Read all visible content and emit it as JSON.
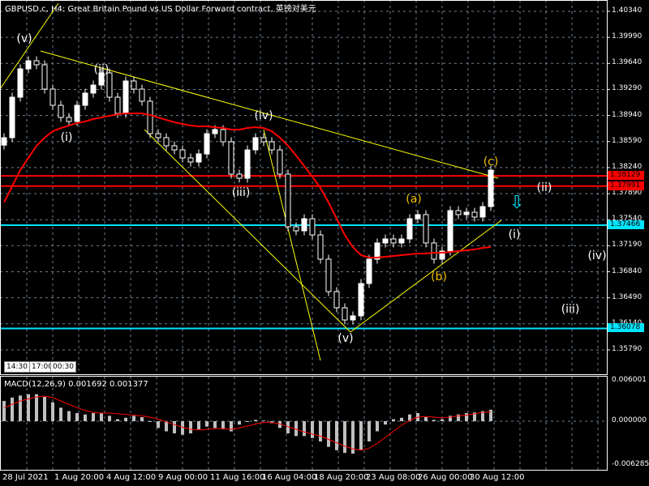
{
  "header": {
    "title": "GBPUSD.c, H4:  Great Britain Pound vs US Dollar Forward contract, 英镑对美元"
  },
  "macd_title": "MACD(12,26,9) 0.001692 0.001377",
  "time_boxes": [
    "14:30",
    "17:00",
    "00:30"
  ],
  "colors": {
    "bg": "#000000",
    "grid": "#6f7f8f",
    "candle": "#ffffff",
    "ma": "#ff0000",
    "trend": "#ffff00",
    "cyan": "#00e5ff",
    "red_level": "#ff0000",
    "macd_hist": "#c0c0c0",
    "macd_signal": "#ff0000"
  },
  "wave_labels": [
    "(v)",
    "(ii)",
    "(i)",
    "(iv)",
    "(iii)",
    "(v)",
    "(a)",
    "(b)",
    "(c)",
    "(ii)",
    "(i)",
    "(iv)",
    "(iii)"
  ],
  "signal_icon": "down-arrow-icon",
  "chart_data": [
    {
      "type": "candlestick",
      "title": "GBPUSD.c, H4",
      "x_tick_labels": [
        "28 Jul 2021",
        "1 Aug 20:00",
        "4 Aug 12:00",
        "9 Aug 00:00",
        "11 Aug 16:00",
        "16 Aug 04:00",
        "18 Aug 20:00",
        "23 Aug 08:00",
        "26 Aug 00:00",
        "30 Aug 12:00"
      ],
      "y_tick_labels": [
        "1.40340",
        "1.39990",
        "1.39640",
        "1.39290",
        "1.38940",
        "1.38590",
        "1.38240",
        "1.37890",
        "1.37540",
        "1.37190",
        "1.36840",
        "1.36490",
        "1.36140",
        "1.35790"
      ],
      "ylim": [
        1.3537,
        1.405
      ],
      "closes": [
        1.38642,
        1.39186,
        1.39567,
        1.39676,
        1.39622,
        1.39295,
        1.39077,
        1.38914,
        1.3886,
        1.39077,
        1.39241,
        1.39349,
        1.39513,
        1.39186,
        1.38968,
        1.39404,
        1.39295,
        1.39132,
        1.38696,
        1.38642,
        1.38533,
        1.38478,
        1.3837,
        1.38315,
        1.38424,
        1.38696,
        1.38751,
        1.38587,
        1.38152,
        1.38097,
        1.38478,
        1.38642,
        1.38587,
        1.38478,
        1.38152,
        1.37444,
        1.3739,
        1.37553,
        1.37335,
        1.37009,
        1.36573,
        1.36356,
        1.36192,
        1.36247,
        1.36682,
        1.37009,
        1.37227,
        1.37281,
        1.37227,
        1.37281,
        1.37553,
        1.37608,
        1.37227,
        1.37009,
        1.37118,
        1.37662,
        1.37608,
        1.3764,
        1.37575,
        1.37716,
        1.38206
      ],
      "moving_average": [
        1.37771,
        1.37989,
        1.38206,
        1.3837,
        1.38533,
        1.38642,
        1.38729,
        1.38772,
        1.38805,
        1.38838,
        1.3886,
        1.38892,
        1.38914,
        1.38936,
        1.38957,
        1.38968,
        1.38968,
        1.38968,
        1.38947,
        1.38914,
        1.38881,
        1.38849,
        1.38827,
        1.38805,
        1.38794,
        1.38794,
        1.38783,
        1.38772,
        1.38751,
        1.38751,
        1.38772,
        1.38783,
        1.38772,
        1.38729,
        1.38642,
        1.38533,
        1.38402,
        1.38261,
        1.38119,
        1.37967,
        1.37771,
        1.37553,
        1.37335,
        1.37172,
        1.37063,
        1.37031,
        1.37031,
        1.37042,
        1.37052,
        1.37063,
        1.37074,
        1.37085,
        1.37085,
        1.37096,
        1.37096,
        1.37107,
        1.37118,
        1.37129,
        1.3714,
        1.37161,
        1.37172
      ],
      "levels": [
        {
          "price": 1.38129,
          "label": "1.38129",
          "color": "#ff0000"
        },
        {
          "price": 1.37991,
          "label": "1.37991",
          "color": "#ff0000"
        },
        {
          "price": 1.37466,
          "label": "1.37466",
          "color": "#00e5ff"
        },
        {
          "price": 1.36078,
          "label": "1.36078",
          "color": "#00e5ff"
        }
      ],
      "grid": true
    },
    {
      "type": "bar+line",
      "title": "MACD(12,26,9)",
      "y_tick_labels": [
        "0.006001",
        "0.000000",
        "-0.006285"
      ],
      "ylim": [
        -0.006285,
        0.006001
      ],
      "histogram": [
        0.003,
        0.0035,
        0.0038,
        0.004,
        0.004,
        0.0036,
        0.0028,
        0.002,
        0.0015,
        0.0012,
        0.001,
        0.0012,
        0.0012,
        0.0008,
        0.0003,
        0.0005,
        0.0008,
        0.0006,
        0.0,
        -0.001,
        -0.0015,
        -0.0018,
        -0.002,
        -0.0018,
        -0.0012,
        -0.0008,
        -0.001,
        -0.0012,
        -0.0015,
        -0.0005,
        0.0,
        0.0002,
        0.0001,
        -0.0003,
        -0.001,
        -0.0018,
        -0.0022,
        -0.0022,
        -0.0025,
        -0.003,
        -0.0038,
        -0.0043,
        -0.0047,
        -0.0048,
        -0.0042,
        -0.003,
        -0.0015,
        -0.0005,
        0.0003,
        0.0005,
        0.001,
        0.0012,
        0.0006,
        0.0002,
        0.0003,
        0.0008,
        0.001,
        0.0012,
        0.0013,
        0.0015,
        0.0017
      ],
      "signal": [
        0.002,
        0.0025,
        0.003,
        0.0033,
        0.0036,
        0.0037,
        0.0035,
        0.003,
        0.0025,
        0.002,
        0.0016,
        0.0013,
        0.0012,
        0.0012,
        0.0011,
        0.001,
        0.0009,
        0.0008,
        0.0006,
        0.0003,
        -0.0001,
        -0.0005,
        -0.0009,
        -0.0012,
        -0.0013,
        -0.0012,
        -0.0011,
        -0.0011,
        -0.0012,
        -0.001,
        -0.0007,
        -0.0004,
        -0.0002,
        -0.0002,
        -0.0004,
        -0.0008,
        -0.0012,
        -0.0016,
        -0.0019,
        -0.0022,
        -0.0027,
        -0.0032,
        -0.0037,
        -0.0041,
        -0.0043,
        -0.004,
        -0.0033,
        -0.0024,
        -0.0015,
        -0.0006,
        0.0001,
        0.0006,
        0.0007,
        0.0006,
        0.0005,
        0.0006,
        0.0008,
        0.0009,
        0.0011,
        0.0013,
        0.0014
      ]
    }
  ]
}
